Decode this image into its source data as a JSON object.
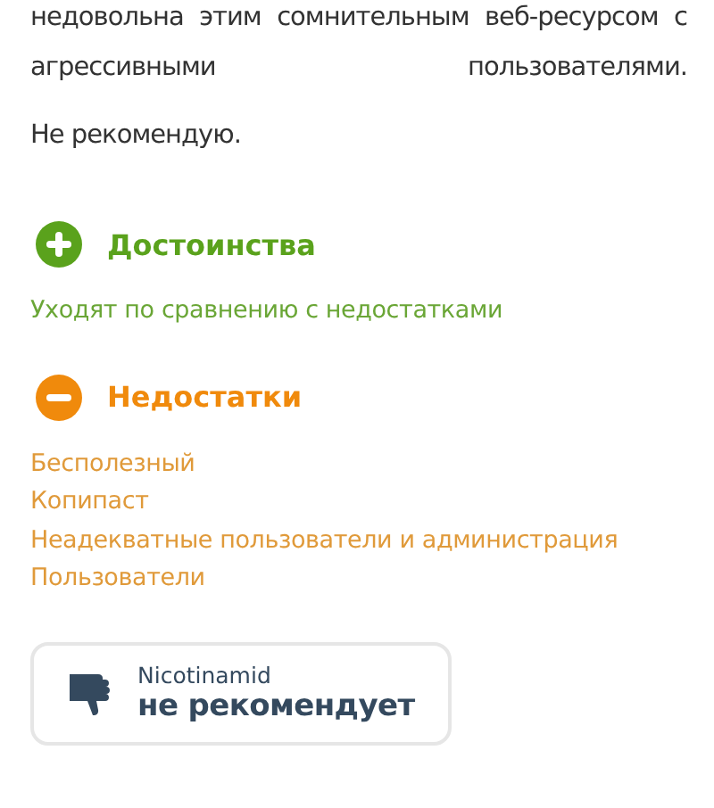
{
  "review": {
    "paragraphs": [
      "недовольна этим сомнительным веб-ресурсом с агрессивными пользователями.",
      "Не рекомендую."
    ]
  },
  "sections": [
    {
      "kind": "pros",
      "title": "Достоинства",
      "items": [
        "Уходят по сравнению с недостатками"
      ]
    },
    {
      "kind": "cons",
      "title": "Недостатки",
      "items": [
        "Бесполезный",
        "Копипаст",
        "Неадекватные пользователи и администрация",
        "Пользователи"
      ]
    }
  ],
  "verdict": {
    "kind": "negative",
    "author": "Nicotinamid",
    "text": "не рекомендует"
  }
}
